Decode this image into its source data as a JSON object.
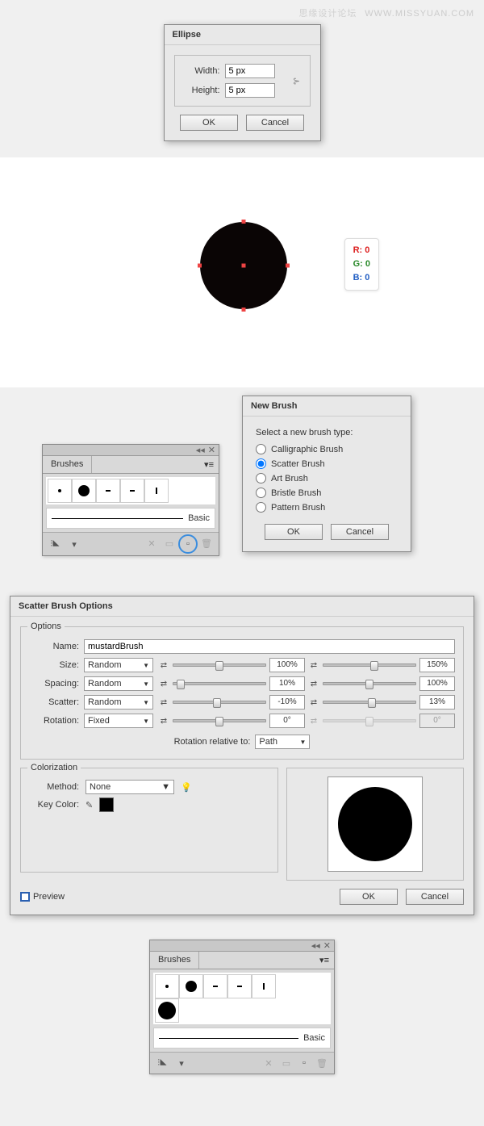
{
  "watermark": {
    "cn": "思缘设计论坛",
    "url": "WWW.MISSYUAN.COM"
  },
  "ellipse": {
    "title": "Ellipse",
    "width_label": "Width:",
    "width_value": "5 px",
    "height_label": "Height:",
    "height_value": "5 px",
    "ok": "OK",
    "cancel": "Cancel"
  },
  "rgb": {
    "r": "R: 0",
    "g": "G: 0",
    "b": "B: 0"
  },
  "brushes_panel": {
    "tab": "Brushes",
    "basic": "Basic"
  },
  "new_brush": {
    "title": "New Brush",
    "heading": "Select a new brush type:",
    "options": [
      "Calligraphic Brush",
      "Scatter Brush",
      "Art Brush",
      "Bristle Brush",
      "Pattern Brush"
    ],
    "selected": "Scatter Brush",
    "ok": "OK",
    "cancel": "Cancel"
  },
  "scatter": {
    "title": "Scatter Brush Options",
    "options_legend": "Options",
    "name_label": "Name:",
    "name_value": "mustardBrush",
    "size_label": "Size:",
    "size_mode": "Random",
    "size_v1": "100%",
    "size_v2": "150%",
    "spacing_label": "Spacing:",
    "spacing_mode": "Random",
    "spacing_v1": "10%",
    "spacing_v2": "100%",
    "scatter_label": "Scatter:",
    "scatter_mode": "Random",
    "scatter_v1": "-10%",
    "scatter_v2": "13%",
    "rotation_label": "Rotation:",
    "rotation_mode": "Fixed",
    "rotation_v1": "0°",
    "rotation_v2": "0°",
    "rot_rel_label": "Rotation relative to:",
    "rot_rel_value": "Path",
    "colorization_legend": "Colorization",
    "method_label": "Method:",
    "method_value": "None",
    "keycolor_label": "Key Color:",
    "preview_label": "Preview",
    "ok": "OK",
    "cancel": "Cancel"
  }
}
